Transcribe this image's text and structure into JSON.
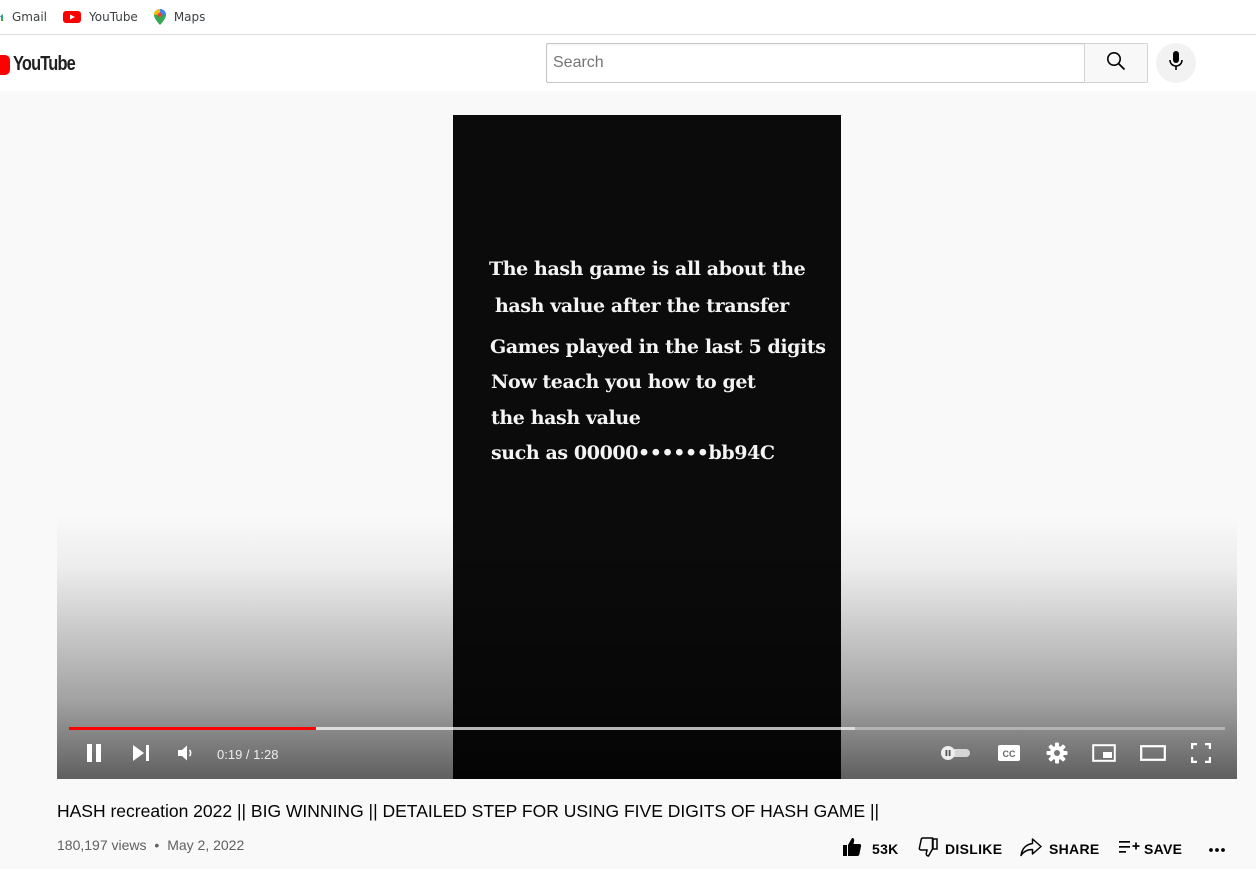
{
  "bookmarks": [
    {
      "label": "Gmail",
      "icon": "gmail-icon"
    },
    {
      "label": "YouTube",
      "icon": "youtube-icon"
    },
    {
      "label": "Maps",
      "icon": "maps-icon"
    }
  ],
  "masthead": {
    "logo_text": "YouTube",
    "search_placeholder": "Search",
    "search_value": ""
  },
  "video": {
    "overlay_lines": [
      "The hash game is all about the",
      "hash value after the transfer",
      "Games played in the last 5 digits",
      "Now teach you how to get",
      "the hash value",
      "such as 00000••••••bb94C"
    ],
    "time_display": "0:19 / 1:28",
    "progress_fraction": 0.214,
    "buffered_fraction": 0.68
  },
  "info": {
    "title": "HASH recreation 2022 || BIG WINNING || DETAILED STEP FOR USING FIVE DIGITS OF HASH GAME ||",
    "views": "180,197 views",
    "separator": "•",
    "date": "May 2, 2022"
  },
  "actions": {
    "like_count": "53K",
    "dislike_label": "DISLIKE",
    "share_label": "SHARE",
    "save_label": "SAVE"
  },
  "colors": {
    "brand_red": "#ff0000",
    "progress_red": "#ff0000",
    "text_primary": "#030303",
    "text_secondary": "#606060"
  }
}
